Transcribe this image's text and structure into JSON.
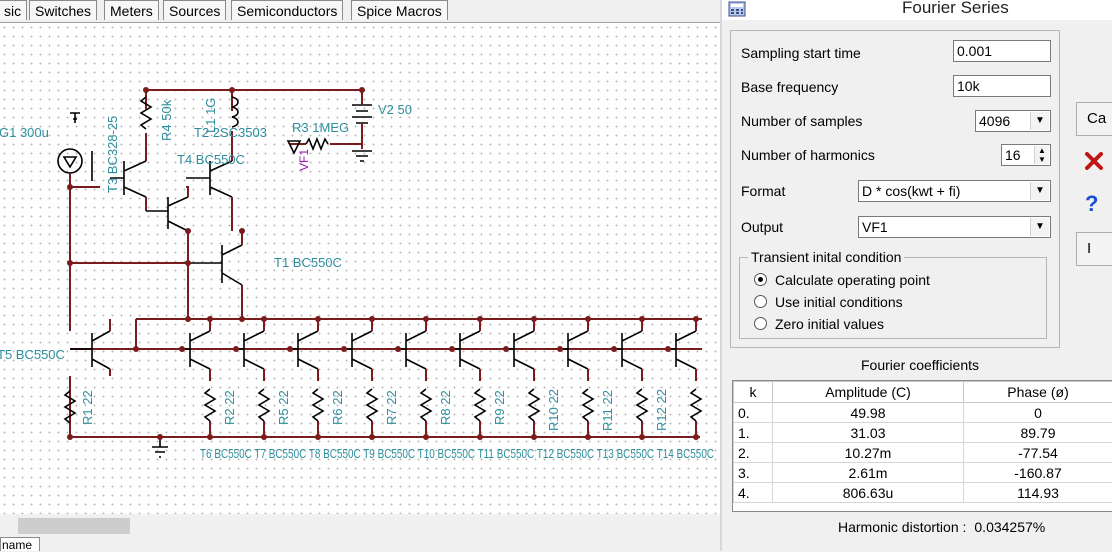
{
  "toolbar_tabs": [
    "sic",
    "Switches",
    "Meters",
    "Sources",
    "Semiconductors",
    "Spice Macros"
  ],
  "schematic": {
    "labels": {
      "g1": "G1 300u",
      "t3": "T3 BC328-25",
      "r4": "R4 50k",
      "l1": "L1 1G",
      "t2": "T2 2SC3503",
      "r3": "R3 1MEG",
      "v2": "V2 50",
      "vf1": "VF1",
      "t4": "T4 BC550C",
      "t1": "T1 BC550C",
      "t5": "T5 BC550C",
      "r1": "R1 22",
      "r2": "R2 22",
      "r5": "R5 22",
      "r6": "R6 22",
      "r7": "R7 22",
      "r8": "R8 22",
      "r9": "R9 22",
      "r10": "R10 22",
      "r11": "R11 22",
      "r12": "R12 22",
      "bottom_row": "T6 BC550C T7 BC550C T8 BC550C T9 BC550C T10 BC550C T11 BC550C T12 BC550C T13 BC550C T14 BC550C"
    },
    "bottom_tab": "name"
  },
  "dialog": {
    "title": "Fourier Series",
    "fields": {
      "sampling_start_label": "Sampling start time",
      "sampling_start_value": "0.001",
      "base_freq_label": "Base frequency",
      "base_freq_value": "10k",
      "num_samples_label": "Number of samples",
      "num_samples_value": "4096",
      "num_harmonics_label": "Number of harmonics",
      "num_harmonics_value": "16",
      "format_label": "Format",
      "format_value": "D * cos(kwt + fi)",
      "output_label": "Output",
      "output_value": "VF1"
    },
    "transient": {
      "legend": "Transient inital condition",
      "options": [
        "Calculate operating point",
        "Use initial conditions",
        "Zero initial values"
      ],
      "selected": 0
    },
    "side_buttons": {
      "calc": "Ca",
      "cancel_icon": "close-x-icon",
      "help_icon": "question-icon",
      "more": "I"
    },
    "coef_title": "Fourier coefficients",
    "coef_headers": [
      "k",
      "Amplitude (C)",
      "Phase (ø)"
    ],
    "coef_rows": [
      [
        "0.",
        "49.98",
        "0"
      ],
      [
        "1.",
        "31.03",
        "89.79"
      ],
      [
        "2.",
        "10.27m",
        "-77.54"
      ],
      [
        "3.",
        "2.61m",
        "-160.87"
      ],
      [
        "4.",
        "806.63u",
        "114.93"
      ]
    ],
    "distortion_label": "Harmonic distortion :",
    "distortion_value": "0.034257%"
  }
}
